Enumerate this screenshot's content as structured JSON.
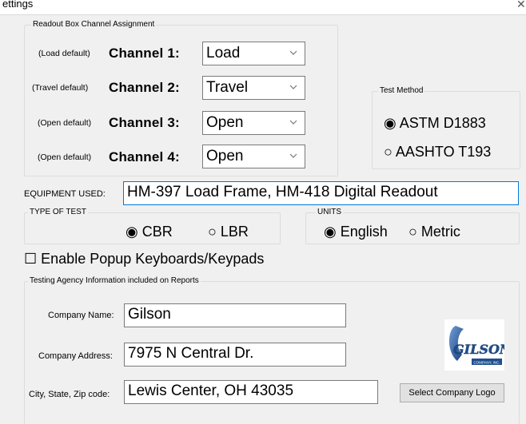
{
  "window": {
    "title": "ettings"
  },
  "readout": {
    "legend": "Readout Box Channel Assignment",
    "channels": [
      {
        "default_label": "(Load default)",
        "label": "Channel 1:",
        "value": "Load"
      },
      {
        "default_label": "(Travel default)",
        "label": "Channel 2:",
        "value": "Travel"
      },
      {
        "default_label": "(Open default)",
        "label": "Channel 3:",
        "value": "Open"
      },
      {
        "default_label": "(Open default)",
        "label": "Channel 4:",
        "value": "Open"
      }
    ]
  },
  "test_method": {
    "legend": "Test Method",
    "options": [
      {
        "label": "ASTM D1883",
        "selected": true
      },
      {
        "label": "AASHTO T193",
        "selected": false
      }
    ]
  },
  "equipment": {
    "label": "EQUIPMENT USED:",
    "value": "HM-397 Load Frame, HM-418 Digital Readout"
  },
  "type_of_test": {
    "legend": "TYPE OF TEST",
    "options": [
      {
        "label": "CBR",
        "selected": true
      },
      {
        "label": "LBR",
        "selected": false
      }
    ]
  },
  "units": {
    "legend": "UNITS",
    "options": [
      {
        "label": "English",
        "selected": true
      },
      {
        "label": "Metric",
        "selected": false
      }
    ]
  },
  "popup": {
    "label": "Enable Popup Keyboards/Keypads",
    "checked": false
  },
  "agency": {
    "legend": "Testing Agency Information included on Reports",
    "company_name_label": "Company Name:",
    "company_name": "Gilson",
    "company_address_label": "Company Address:",
    "company_address": "7975 N Central Dr.",
    "city_label": "City, State, Zip code:",
    "city": "Lewis Center, OH 43035",
    "logo_button": "Select Company Logo",
    "logo_text": "GILSON",
    "logo_sub": "COMPANY, INC."
  },
  "glyphs": {
    "radio_on": "◉",
    "radio_off": "○",
    "checkbox_off": "☐"
  },
  "colors": {
    "accent_border": "#0078d7",
    "logo_blue": "#1f4f8f"
  }
}
